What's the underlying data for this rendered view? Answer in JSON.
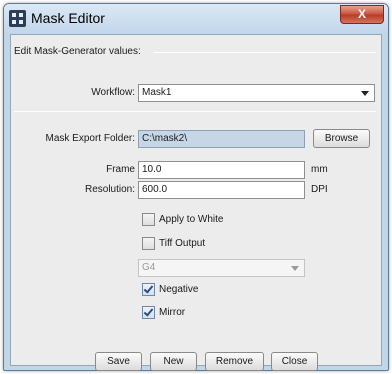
{
  "window": {
    "title": "Mask Editor",
    "close_glyph": "X"
  },
  "section": {
    "header": "Edit Mask-Generator values:"
  },
  "workflow": {
    "label": "Workflow:",
    "value": "Mask1"
  },
  "export": {
    "label": "Mask Export Folder:",
    "value": "C:\\mask2\\",
    "browse_label": "Browse"
  },
  "frame": {
    "label": "Frame",
    "value": "10.0",
    "unit": "mm"
  },
  "resolution": {
    "label": "Resolution:",
    "value": "600.0",
    "unit": "DPI"
  },
  "options": {
    "apply_to_white": {
      "label": "Apply to White",
      "checked": false
    },
    "tiff_output": {
      "label": "Tiff Output",
      "checked": false
    },
    "compression": {
      "value": "G4",
      "enabled": false
    },
    "negative": {
      "label": "Negative",
      "checked": true
    },
    "mirror": {
      "label": "Mirror",
      "checked": true
    }
  },
  "buttons": {
    "save": "Save",
    "new": "New",
    "remove": "Remove",
    "close": "Close"
  }
}
